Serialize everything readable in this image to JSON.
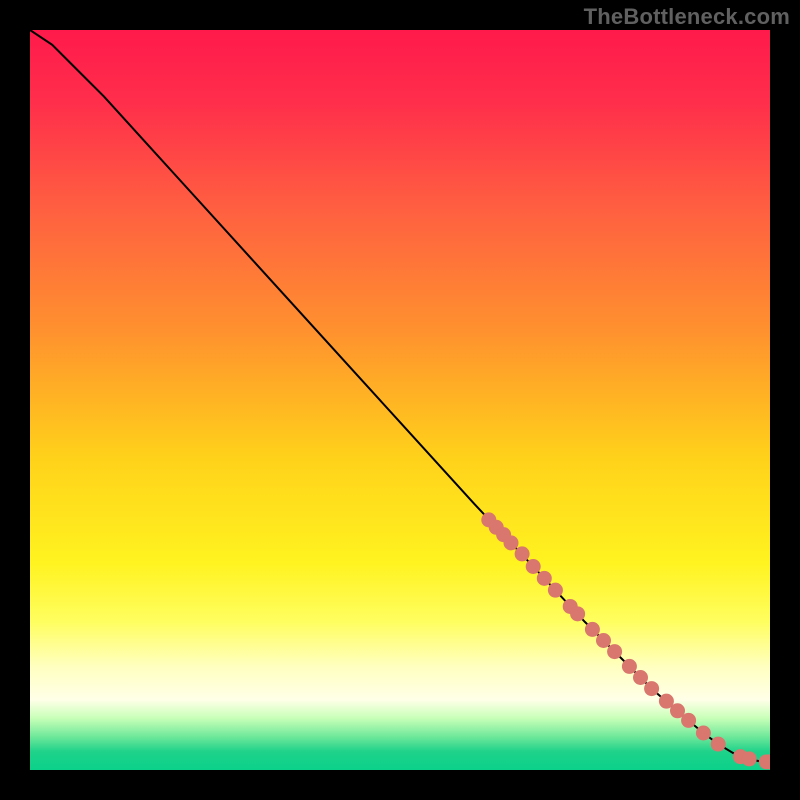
{
  "watermark": "TheBottleneck.com",
  "colors": {
    "background": "#000000",
    "curve": "#000000",
    "markers_fill": "#d9766d",
    "markers_stroke": "#8a3a33",
    "gradient_stops": [
      {
        "offset": 0.0,
        "color": "#ff1a4b"
      },
      {
        "offset": 0.1,
        "color": "#ff2f4b"
      },
      {
        "offset": 0.25,
        "color": "#ff6240"
      },
      {
        "offset": 0.4,
        "color": "#ff8f2f"
      },
      {
        "offset": 0.58,
        "color": "#ffd21a"
      },
      {
        "offset": 0.72,
        "color": "#fff320"
      },
      {
        "offset": 0.8,
        "color": "#fffe60"
      },
      {
        "offset": 0.86,
        "color": "#ffffc0"
      },
      {
        "offset": 0.905,
        "color": "#ffffe8"
      },
      {
        "offset": 0.93,
        "color": "#c8ffb8"
      },
      {
        "offset": 0.955,
        "color": "#6fe89a"
      },
      {
        "offset": 0.975,
        "color": "#1fd28a"
      },
      {
        "offset": 1.0,
        "color": "#0bd18a"
      }
    ]
  },
  "chart_data": {
    "type": "line",
    "title": "",
    "xlabel": "",
    "ylabel": "",
    "xlim": [
      0,
      100
    ],
    "ylim": [
      0,
      100
    ],
    "series": [
      {
        "name": "bottleneck-curve",
        "x": [
          0,
          3,
          6,
          10,
          15,
          20,
          30,
          40,
          50,
          60,
          68,
          75,
          80,
          84,
          88,
          91,
          93,
          95,
          97,
          98.5,
          100
        ],
        "y": [
          100,
          98,
          95,
          91,
          85.5,
          80,
          69,
          58,
          47,
          36,
          27.5,
          20,
          15,
          11,
          7.5,
          5,
          3.5,
          2.3,
          1.5,
          1.2,
          1.1
        ]
      }
    ],
    "markers": [
      {
        "x": 62.0,
        "y": 33.8
      },
      {
        "x": 63.0,
        "y": 32.8
      },
      {
        "x": 64.0,
        "y": 31.8
      },
      {
        "x": 65.0,
        "y": 30.7
      },
      {
        "x": 66.5,
        "y": 29.2
      },
      {
        "x": 68.0,
        "y": 27.5
      },
      {
        "x": 69.5,
        "y": 25.9
      },
      {
        "x": 71.0,
        "y": 24.3
      },
      {
        "x": 73.0,
        "y": 22.1
      },
      {
        "x": 74.0,
        "y": 21.1
      },
      {
        "x": 76.0,
        "y": 19.0
      },
      {
        "x": 77.5,
        "y": 17.5
      },
      {
        "x": 79.0,
        "y": 16.0
      },
      {
        "x": 81.0,
        "y": 14.0
      },
      {
        "x": 82.5,
        "y": 12.5
      },
      {
        "x": 84.0,
        "y": 11.0
      },
      {
        "x": 86.0,
        "y": 9.3
      },
      {
        "x": 87.5,
        "y": 8.0
      },
      {
        "x": 89.0,
        "y": 6.7
      },
      {
        "x": 91.0,
        "y": 5.0
      },
      {
        "x": 93.0,
        "y": 3.5
      },
      {
        "x": 96.0,
        "y": 1.8
      },
      {
        "x": 97.2,
        "y": 1.5
      },
      {
        "x": 99.5,
        "y": 1.1
      },
      {
        "x": 100.0,
        "y": 1.1
      }
    ]
  }
}
